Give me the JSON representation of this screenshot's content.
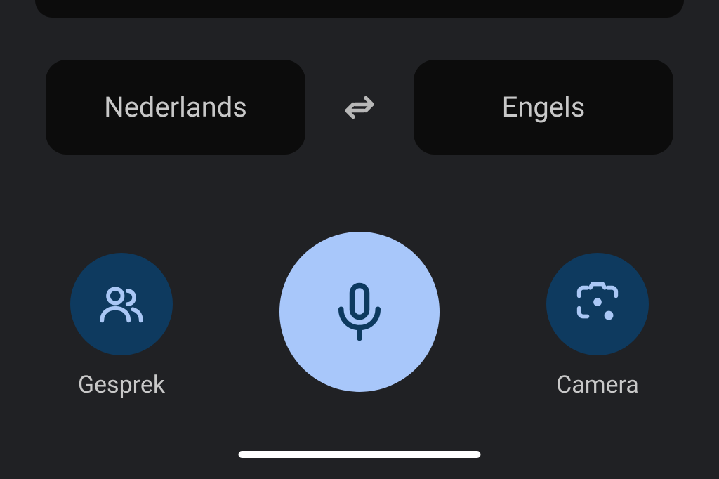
{
  "languages": {
    "source": "Nederlands",
    "target": "Engels"
  },
  "actions": {
    "conversation": {
      "label": "Gesprek"
    },
    "camera": {
      "label": "Camera"
    }
  },
  "colors": {
    "background": "#202124",
    "button_dark": "#0c0c0c",
    "circle_dark_blue": "#0e3a5f",
    "circle_light_blue": "#a8c7fa",
    "mic_icon": "#0d3a5f",
    "icon_light": "#aac7f5",
    "text": "#c8c8c8"
  }
}
